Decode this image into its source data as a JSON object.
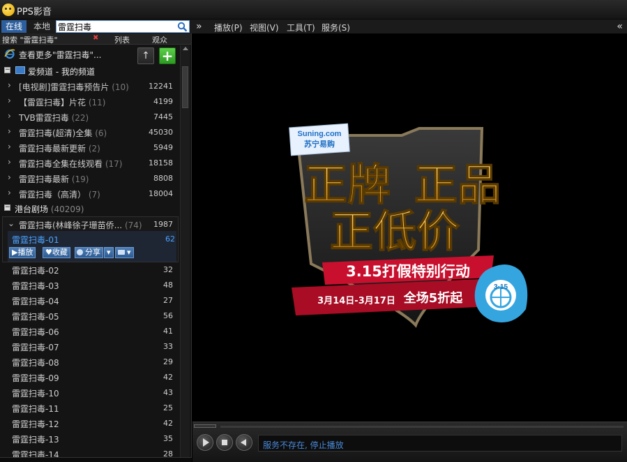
{
  "app": {
    "title": "PPS影音"
  },
  "tabs": {
    "online": "在线",
    "local": "本地"
  },
  "search": {
    "value": "雷霆扫毒",
    "label": "搜索 \"雷霆扫毒\"",
    "clear": "✖"
  },
  "columns": {
    "list": "列表",
    "views": "观众"
  },
  "menu": {
    "collapse": "»",
    "expand": "«",
    "items": [
      "播放(P)",
      "视图(V)",
      "工具(T)",
      "服务(S)"
    ]
  },
  "more": {
    "text": "查看更多\"雷霆扫毒\"...",
    "up": "↑",
    "add": "+"
  },
  "categories": [
    {
      "toggle": "−",
      "label": "爱频道 - 我的频道",
      "count": ""
    },
    {
      "toggle": "−",
      "label": "港台剧场",
      "count": "(40209)"
    }
  ],
  "channel_items": [
    {
      "name": "[电视剧]雷霆扫毒预告片",
      "count": "(10)",
      "views": "12241"
    },
    {
      "name": "【雷霆扫毒】片花",
      "count": "(11)",
      "views": "4199"
    },
    {
      "name": "TVB雷霆扫毒",
      "count": "(22)",
      "views": "7445"
    },
    {
      "name": "雷霆扫毒(超清)全集",
      "count": "(6)",
      "views": "45030"
    },
    {
      "name": "雷霆扫毒最新更新",
      "count": "(2)",
      "views": "5949"
    },
    {
      "name": "雷霆扫毒全集在线观看",
      "count": "(17)",
      "views": "18158"
    },
    {
      "name": "雷霆扫毒最新",
      "count": "(19)",
      "views": "8808"
    },
    {
      "name": "雷霆扫毒（高清）",
      "count": "(7)",
      "views": "18004"
    }
  ],
  "expanded_group": {
    "name": "雷霆扫毒(林峰徐子珊苗侨...",
    "count": "(74)",
    "views": "1987"
  },
  "selected_episode": {
    "name": "雷霆扫毒-01",
    "views": "62",
    "buttons": {
      "play": "▶播放",
      "fav": "♥收藏",
      "share": "分享",
      "share_arrow": "▾",
      "more_arrow": "▾"
    }
  },
  "episodes": [
    {
      "name": "雷霆扫毒-02",
      "views": "32"
    },
    {
      "name": "雷霆扫毒-03",
      "views": "48"
    },
    {
      "name": "雷霆扫毒-04",
      "views": "27"
    },
    {
      "name": "雷霆扫毒-05",
      "views": "56"
    },
    {
      "name": "雷霆扫毒-06",
      "views": "41"
    },
    {
      "name": "雷霆扫毒-07",
      "views": "33"
    },
    {
      "name": "雷霆扫毒-08",
      "views": "29"
    },
    {
      "name": "雷霆扫毒-09",
      "views": "42"
    },
    {
      "name": "雷霆扫毒-10",
      "views": "43"
    },
    {
      "name": "雷霆扫毒-11",
      "views": "25"
    },
    {
      "name": "雷霆扫毒-12",
      "views": "42"
    },
    {
      "name": "雷霆扫毒-13",
      "views": "35"
    },
    {
      "name": "雷霆扫毒-14",
      "views": "28"
    }
  ],
  "ad": {
    "badge_brand": "Suning.com",
    "badge_name": "苏宁易购",
    "line1a": "正牌",
    "line1b": "正品",
    "line2": "正低价",
    "ribbon1": "3.15打假特别行动",
    "ribbon2_date": "3月14日-3月17日",
    "ribbon2_offer": "全场5折起",
    "seal": "3·15"
  },
  "player": {
    "status": "服务不存在, 停止播放"
  },
  "colors": {
    "accent": "#2d5f9e",
    "highlight": "#4aa3ff",
    "gold": "#f2b742",
    "ribbon_red": "#c8102e"
  }
}
